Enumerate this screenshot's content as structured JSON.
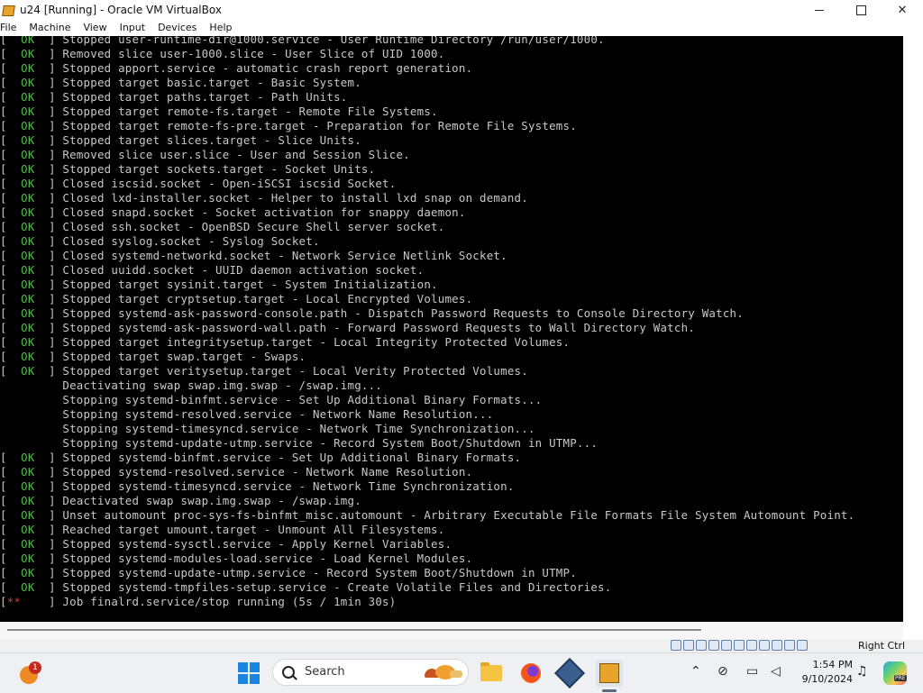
{
  "window": {
    "title": "u24 [Running] - Oracle VM VirtualBox",
    "minimize_label": "—",
    "maximize_label": "□",
    "close_label": "✕"
  },
  "menu": [
    "File",
    "Machine",
    "View",
    "Input",
    "Devices",
    "Help"
  ],
  "console": {
    "lines": [
      {
        "status": "  OK  ",
        "text": "Stopped user-runtime-dir@1000.service - User Runtime Directory /run/user/1000."
      },
      {
        "status": "  OK  ",
        "text": "Removed slice user-1000.slice - User Slice of UID 1000."
      },
      {
        "status": "  OK  ",
        "text": "Stopped apport.service - automatic crash report generation."
      },
      {
        "status": "  OK  ",
        "text": "Stopped target basic.target - Basic System."
      },
      {
        "status": "  OK  ",
        "text": "Stopped target paths.target - Path Units."
      },
      {
        "status": "  OK  ",
        "text": "Stopped target remote-fs.target - Remote File Systems."
      },
      {
        "status": "  OK  ",
        "text": "Stopped target remote-fs-pre.target - Preparation for Remote File Systems."
      },
      {
        "status": "  OK  ",
        "text": "Stopped target slices.target - Slice Units."
      },
      {
        "status": "  OK  ",
        "text": "Removed slice user.slice - User and Session Slice."
      },
      {
        "status": "  OK  ",
        "text": "Stopped target sockets.target - Socket Units."
      },
      {
        "status": "  OK  ",
        "text": "Closed iscsid.socket - Open-iSCSI iscsid Socket."
      },
      {
        "status": "  OK  ",
        "text": "Closed lxd-installer.socket - Helper to install lxd snap on demand."
      },
      {
        "status": "  OK  ",
        "text": "Closed snapd.socket - Socket activation for snappy daemon."
      },
      {
        "status": "  OK  ",
        "text": "Closed ssh.socket - OpenBSD Secure Shell server socket."
      },
      {
        "status": "  OK  ",
        "text": "Closed syslog.socket - Syslog Socket."
      },
      {
        "status": "  OK  ",
        "text": "Closed systemd-networkd.socket - Network Service Netlink Socket."
      },
      {
        "status": "  OK  ",
        "text": "Closed uuidd.socket - UUID daemon activation socket."
      },
      {
        "status": "  OK  ",
        "text": "Stopped target sysinit.target - System Initialization."
      },
      {
        "status": "  OK  ",
        "text": "Stopped target cryptsetup.target - Local Encrypted Volumes."
      },
      {
        "status": "  OK  ",
        "text": "Stopped systemd-ask-password-console.path - Dispatch Password Requests to Console Directory Watch."
      },
      {
        "status": "  OK  ",
        "text": "Stopped systemd-ask-password-wall.path - Forward Password Requests to Wall Directory Watch."
      },
      {
        "status": "  OK  ",
        "text": "Stopped target integritysetup.target - Local Integrity Protected Volumes."
      },
      {
        "status": "  OK  ",
        "text": "Stopped target swap.target - Swaps."
      },
      {
        "status": "  OK  ",
        "text": "Stopped target veritysetup.target - Local Verity Protected Volumes."
      },
      {
        "status": "",
        "text": "Deactivating swap swap.img.swap - /swap.img..."
      },
      {
        "status": "",
        "text": "Stopping systemd-binfmt.service - Set Up Additional Binary Formats..."
      },
      {
        "status": "",
        "text": "Stopping systemd-resolved.service - Network Name Resolution..."
      },
      {
        "status": "",
        "text": "Stopping systemd-timesyncd.service - Network Time Synchronization..."
      },
      {
        "status": "",
        "text": "Stopping systemd-update-utmp.service - Record System Boot/Shutdown in UTMP..."
      },
      {
        "status": "  OK  ",
        "text": "Stopped systemd-binfmt.service - Set Up Additional Binary Formats."
      },
      {
        "status": "  OK  ",
        "text": "Stopped systemd-resolved.service - Network Name Resolution."
      },
      {
        "status": "  OK  ",
        "text": "Stopped systemd-timesyncd.service - Network Time Synchronization."
      },
      {
        "status": "  OK  ",
        "text": "Deactivated swap swap.img.swap - /swap.img."
      },
      {
        "status": "  OK  ",
        "text": "Unset automount proc-sys-fs-binfmt_misc.automount - Arbitrary Executable File Formats File System Automount Point."
      },
      {
        "status": "  OK  ",
        "text": "Reached target umount.target - Unmount All Filesystems."
      },
      {
        "status": "  OK  ",
        "text": "Stopped systemd-sysctl.service - Apply Kernel Variables."
      },
      {
        "status": "  OK  ",
        "text": "Stopped systemd-modules-load.service - Load Kernel Modules."
      },
      {
        "status": "  OK  ",
        "text": "Stopped systemd-update-utmp.service - Record System Boot/Shutdown in UTMP."
      },
      {
        "status": "  OK  ",
        "text": "Stopped systemd-tmpfiles-setup.service - Create Volatile Files and Directories."
      },
      {
        "status": "**    ",
        "text": "Job finalrd.service/stop running (5s / 1min 30s)"
      }
    ]
  },
  "statusbar": {
    "host_key": "Right Ctrl"
  },
  "taskbar": {
    "weather_badge": "1",
    "search_placeholder": "Search",
    "time": "1:54 PM",
    "date": "9/10/2024",
    "copilot_badge": "PRE"
  },
  "colors": {
    "ok": "#4fbf45",
    "fail": "#d23c3c",
    "console_bg": "#000000",
    "start_blue": "#1a86e0"
  }
}
